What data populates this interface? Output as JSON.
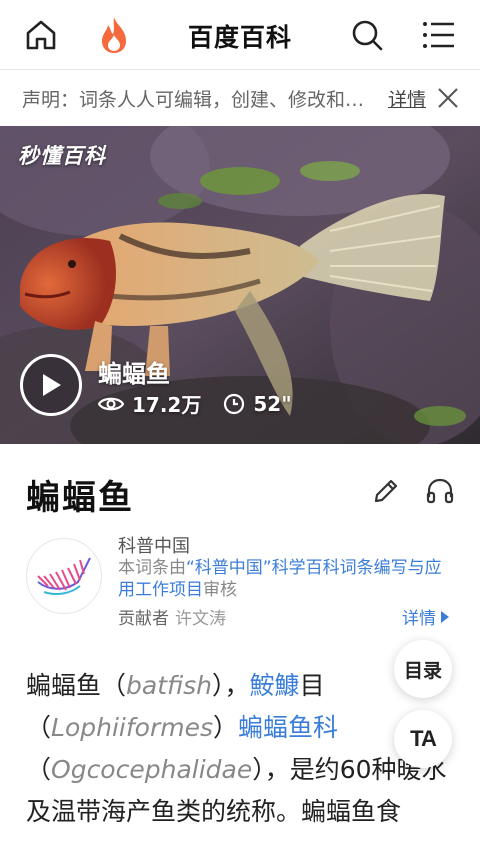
{
  "header": {
    "title": "百度百科",
    "icons": {
      "home": "home-icon",
      "hot": "flame-icon",
      "search": "search-icon",
      "menu": "menu-icon"
    }
  },
  "notice": {
    "text": "声明：词条人人可编辑，创建、修改和认证均免费",
    "detail_label": "详情",
    "close_icon": "close-icon"
  },
  "video": {
    "logo": "秒懂百科",
    "title": "蝙蝠鱼",
    "views": "17.2万",
    "duration": "52\"",
    "play_icon": "play-icon"
  },
  "entry": {
    "title": "蝙蝠鱼",
    "edit_icon": "pencil-icon",
    "listen_icon": "headphones-icon"
  },
  "review": {
    "org": "科普中国",
    "desc_prefix": "本词条由",
    "desc_highlight": "“科普中国”科学百科词条编写与应用工作项目",
    "desc_suffix": "审核",
    "contributor_label": "贡献者",
    "contributor_name": "许文涛",
    "detail_label": "详情"
  },
  "body": {
    "t1": "蝙蝠鱼（",
    "t2": "batfish",
    "t3": "），",
    "link1": "鮟鱇",
    "t4": "目（",
    "t5": "Lophiiformes",
    "t6": "）",
    "link2": "蝙蝠鱼科",
    "t7": "（",
    "t8": "Ogcocephalidae",
    "t9": "），是约60种暖水及温带海产鱼类的统称。蝙蝠鱼食"
  },
  "floating": {
    "toc_label": "目录",
    "ta_label": "TA"
  },
  "colors": {
    "link": "#3b7ed9",
    "brand_orange": "#f46a3c"
  }
}
